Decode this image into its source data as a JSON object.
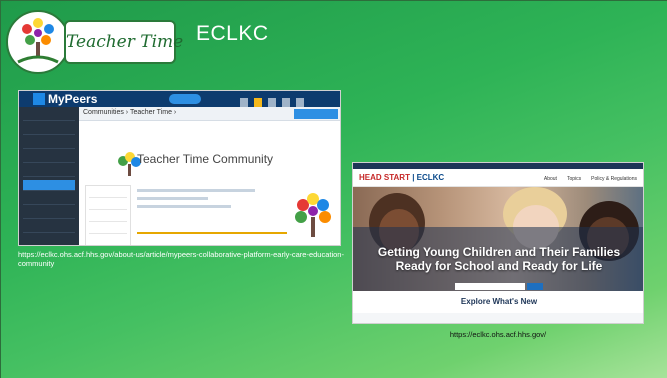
{
  "header": {
    "logo_text": "Teacher Time",
    "title": "ECLKC"
  },
  "left_screenshot": {
    "app_name": "MyPeers",
    "breadcrumb": "Communities › Teacher Time ›",
    "community_title": "Teacher Time Community",
    "caption": "https://eclkc.ohs.acf.hhs.gov/about-us/article/mypeers-collaborative-platform-early-care-education-community"
  },
  "right_screenshot": {
    "brand_prefix": "HEAD START",
    "brand_suffix": " | ECLKC",
    "nav_links": [
      "About",
      "Topics",
      "Policy & Regulations"
    ],
    "headline_line1": "Getting Young Children and Their Families",
    "headline_line2": "Ready for School and Ready for Life",
    "explore": "Explore What's New",
    "caption": "https://eclkc.ohs.acf.hhs.gov/"
  },
  "colors": {
    "background_green": "#2eb356",
    "mypeers_navy": "#0d3b6e",
    "eclkc_navy": "#1d3557"
  }
}
